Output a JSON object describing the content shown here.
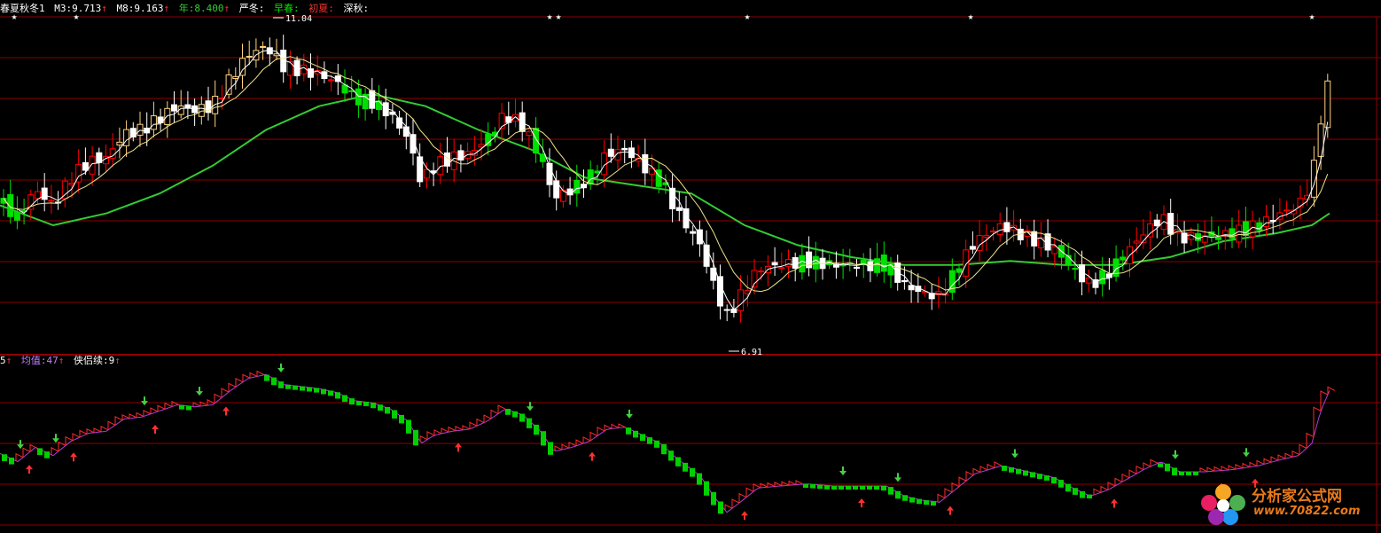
{
  "upper_header": {
    "name": "春夏秋冬1",
    "m3_label": "M3:",
    "m3_value": "9.713",
    "m8_label": "M8:",
    "m8_value": "9.163",
    "year_label": "年:",
    "year_value": "8.400",
    "arrow": "↑",
    "winter": "严冬:",
    "early_spring": "早春:",
    "early_summer": "初夏:",
    "late_autumn": "深秋:"
  },
  "lower_header": {
    "v1": "5",
    "avg_label": "均值:",
    "avg_value": "47",
    "xia_label": "侠侣续:",
    "xia_value": "9",
    "arrow": "↑"
  },
  "annotations": {
    "high": "11.04",
    "low": "6.91"
  },
  "logo": {
    "text": "分析家公式网",
    "url": "www.70822.com"
  },
  "colors": {
    "background": "#000000",
    "grid": "#8b0000",
    "up": "#ff0000",
    "down": "#ffffff",
    "spring": "#00e000",
    "summer": "#ffd27f",
    "m3": "#ffffff",
    "m8": "#f0e68c",
    "year": "#33cc33",
    "lower_line": "#b03cd6",
    "lower_red": "#ff2a2a",
    "lower_green": "#00d000",
    "arrow_up": "#ff3030",
    "arrow_down": "#44d044"
  },
  "chart_data": [
    {
      "type": "candlestick",
      "title": "春夏秋冬1",
      "price_range": [
        6.91,
        11.04
      ],
      "series": [
        {
          "name": "M3",
          "value": 9.713
        },
        {
          "name": "M8",
          "value": 9.163
        },
        {
          "name": "年",
          "value": 8.4
        }
      ],
      "close_path": [
        [
          0,
          8.75
        ],
        [
          20,
          8.55
        ],
        [
          40,
          8.9
        ],
        [
          60,
          8.7
        ],
        [
          80,
          9.05
        ],
        [
          100,
          9.25
        ],
        [
          120,
          9.3
        ],
        [
          140,
          9.6
        ],
        [
          160,
          9.65
        ],
        [
          180,
          9.8
        ],
        [
          200,
          9.95
        ],
        [
          220,
          9.9
        ],
        [
          240,
          9.95
        ],
        [
          260,
          10.3
        ],
        [
          280,
          10.6
        ],
        [
          300,
          10.7
        ],
        [
          320,
          10.45
        ],
        [
          340,
          10.4
        ],
        [
          360,
          10.35
        ],
        [
          380,
          10.25
        ],
        [
          400,
          10.05
        ],
        [
          420,
          10.0
        ],
        [
          440,
          9.85
        ],
        [
          460,
          9.55
        ],
        [
          475,
          9.0
        ],
        [
          490,
          9.2
        ],
        [
          510,
          9.3
        ],
        [
          530,
          9.35
        ],
        [
          550,
          9.55
        ],
        [
          570,
          9.85
        ],
        [
          590,
          9.7
        ],
        [
          610,
          9.3
        ],
        [
          625,
          8.8
        ],
        [
          645,
          8.9
        ],
        [
          665,
          9.05
        ],
        [
          685,
          9.35
        ],
        [
          705,
          9.4
        ],
        [
          720,
          9.25
        ],
        [
          745,
          9.0
        ],
        [
          765,
          8.6
        ],
        [
          790,
          8.2
        ],
        [
          805,
          7.7
        ],
        [
          820,
          7.3
        ],
        [
          835,
          7.55
        ],
        [
          855,
          7.9
        ],
        [
          880,
          7.95
        ],
        [
          910,
          8.0
        ],
        [
          940,
          7.95
        ],
        [
          970,
          7.95
        ],
        [
          1000,
          7.95
        ],
        [
          1020,
          7.7
        ],
        [
          1040,
          7.6
        ],
        [
          1060,
          7.55
        ],
        [
          1080,
          7.9
        ],
        [
          1100,
          8.25
        ],
        [
          1130,
          8.45
        ],
        [
          1160,
          8.3
        ],
        [
          1190,
          8.15
        ],
        [
          1210,
          7.9
        ],
        [
          1230,
          7.7
        ],
        [
          1250,
          7.85
        ],
        [
          1270,
          8.1
        ],
        [
          1290,
          8.35
        ],
        [
          1310,
          8.55
        ],
        [
          1330,
          8.3
        ],
        [
          1360,
          8.3
        ],
        [
          1390,
          8.35
        ],
        [
          1420,
          8.45
        ],
        [
          1445,
          8.6
        ],
        [
          1465,
          8.7
        ],
        [
          1480,
          9.0
        ],
        [
          1490,
          9.8
        ],
        [
          1500,
          10.3
        ]
      ],
      "year_line": [
        [
          0,
          8.7
        ],
        [
          60,
          8.45
        ],
        [
          120,
          8.6
        ],
        [
          180,
          8.85
        ],
        [
          240,
          9.2
        ],
        [
          300,
          9.65
        ],
        [
          360,
          9.95
        ],
        [
          420,
          10.1
        ],
        [
          480,
          9.95
        ],
        [
          540,
          9.65
        ],
        [
          600,
          9.4
        ],
        [
          660,
          9.05
        ],
        [
          720,
          8.95
        ],
        [
          780,
          8.85
        ],
        [
          840,
          8.45
        ],
        [
          900,
          8.2
        ],
        [
          960,
          8.05
        ],
        [
          1020,
          7.95
        ],
        [
          1080,
          7.95
        ],
        [
          1140,
          8.0
        ],
        [
          1200,
          7.95
        ],
        [
          1260,
          7.95
        ],
        [
          1320,
          8.05
        ],
        [
          1380,
          8.25
        ],
        [
          1440,
          8.35
        ],
        [
          1480,
          8.45
        ],
        [
          1500,
          8.6
        ]
      ],
      "special_labels": [
        {
          "text": "11.04",
          "x": 308,
          "y": 11.04
        },
        {
          "text": "6.91",
          "x": 822,
          "y": 6.91
        }
      ],
      "stars_x": [
        16,
        86,
        620,
        630,
        843,
        1095,
        1480
      ]
    },
    {
      "type": "line",
      "title": "侠侣续",
      "series": [
        {
          "name": "均值",
          "value": 47
        },
        {
          "name": "侠侣续",
          "value": 9
        }
      ],
      "up_arrows_x": [
        33,
        83,
        175,
        255,
        517,
        668,
        840,
        972,
        1072,
        1257,
        1378,
        1416
      ],
      "down_arrows_x": [
        23,
        63,
        163,
        225,
        317,
        598,
        710,
        951,
        1013,
        1145,
        1326,
        1406
      ]
    }
  ]
}
